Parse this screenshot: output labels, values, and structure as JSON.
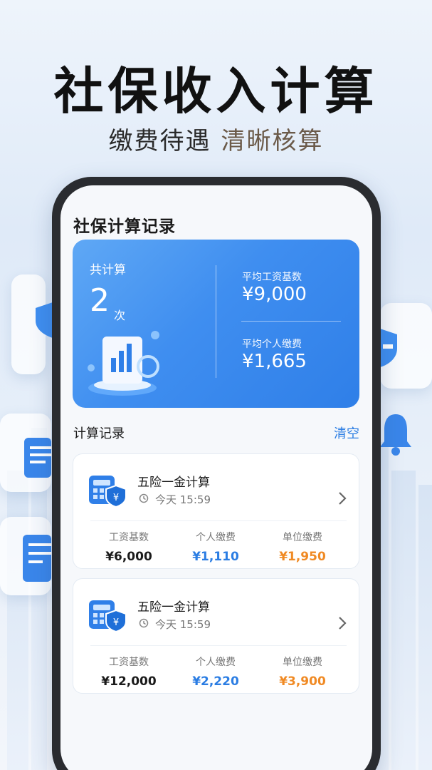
{
  "hero": {
    "title": "社保收入计算",
    "subtitle_part1": "缴费待遇",
    "subtitle_part2": "清晰核算"
  },
  "page": {
    "title": "社保计算记录"
  },
  "summary": {
    "count_label": "共计算",
    "count": "2",
    "count_unit": "次",
    "avg_base_label": "平均工资基数",
    "avg_base_value": "¥9,000",
    "avg_personal_label": "平均个人缴费",
    "avg_personal_value": "¥1,665"
  },
  "records": {
    "title": "计算记录",
    "clear_label": "清空",
    "items": [
      {
        "name": "五险一金计算",
        "time": "今天 15:59",
        "base_label": "工资基数",
        "base": "¥6,000",
        "personal_label": "个人缴费",
        "personal": "¥1,110",
        "company_label": "单位缴费",
        "company": "¥1,950"
      },
      {
        "name": "五险一金计算",
        "time": "今天 15:59",
        "base_label": "工资基数",
        "base": "¥12,000",
        "personal_label": "个人缴费",
        "personal": "¥2,220",
        "company_label": "单位缴费",
        "company": "¥3,900"
      }
    ]
  },
  "colors": {
    "accent": "#2b7de3",
    "orange": "#f08a24",
    "card_gradient_start": "#5fa8f5",
    "card_gradient_end": "#2f7fe8"
  },
  "icons": [
    "shield-icon",
    "bell-icon",
    "document-icon",
    "calculator-icon",
    "clock-icon",
    "chevron-right-icon",
    "chart-illustration"
  ]
}
